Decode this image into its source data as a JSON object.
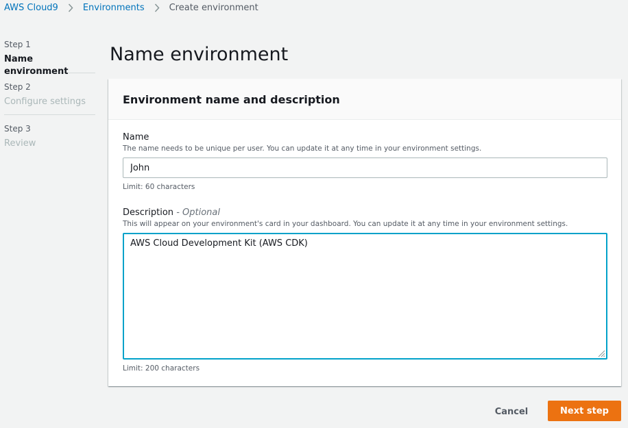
{
  "breadcrumb": {
    "items": [
      {
        "label": "AWS Cloud9",
        "link": true
      },
      {
        "label": "Environments",
        "link": true
      },
      {
        "label": "Create environment",
        "link": false
      }
    ]
  },
  "steps": [
    {
      "number": "Step 1",
      "title": "Name environment",
      "active": true
    },
    {
      "number": "Step 2",
      "title": "Configure settings",
      "active": false
    },
    {
      "number": "Step 3",
      "title": "Review",
      "active": false
    }
  ],
  "page": {
    "title": "Name environment"
  },
  "card": {
    "title": "Environment name and description",
    "name_field": {
      "label": "Name",
      "description": "The name needs to be unique per user. You can update it at any time in your environment settings.",
      "value": "John",
      "limit": "Limit: 60 characters"
    },
    "description_field": {
      "label": "Description",
      "optional": "- Optional",
      "description": "This will appear on your environment's card in your dashboard. You can update it at any time in your environment settings.",
      "value": "AWS Cloud Development Kit (AWS CDK)",
      "limit": "Limit: 200 characters"
    }
  },
  "actions": {
    "cancel_label": "Cancel",
    "next_label": "Next step"
  },
  "colors": {
    "link": "#0073bb",
    "primary_button": "#ec7211",
    "focus_border": "#00a1c9",
    "background": "#f2f3f3"
  },
  "icons": {
    "breadcrumb_separator": "chevron-right-icon",
    "textarea_resize": "resize-grip-icon"
  }
}
